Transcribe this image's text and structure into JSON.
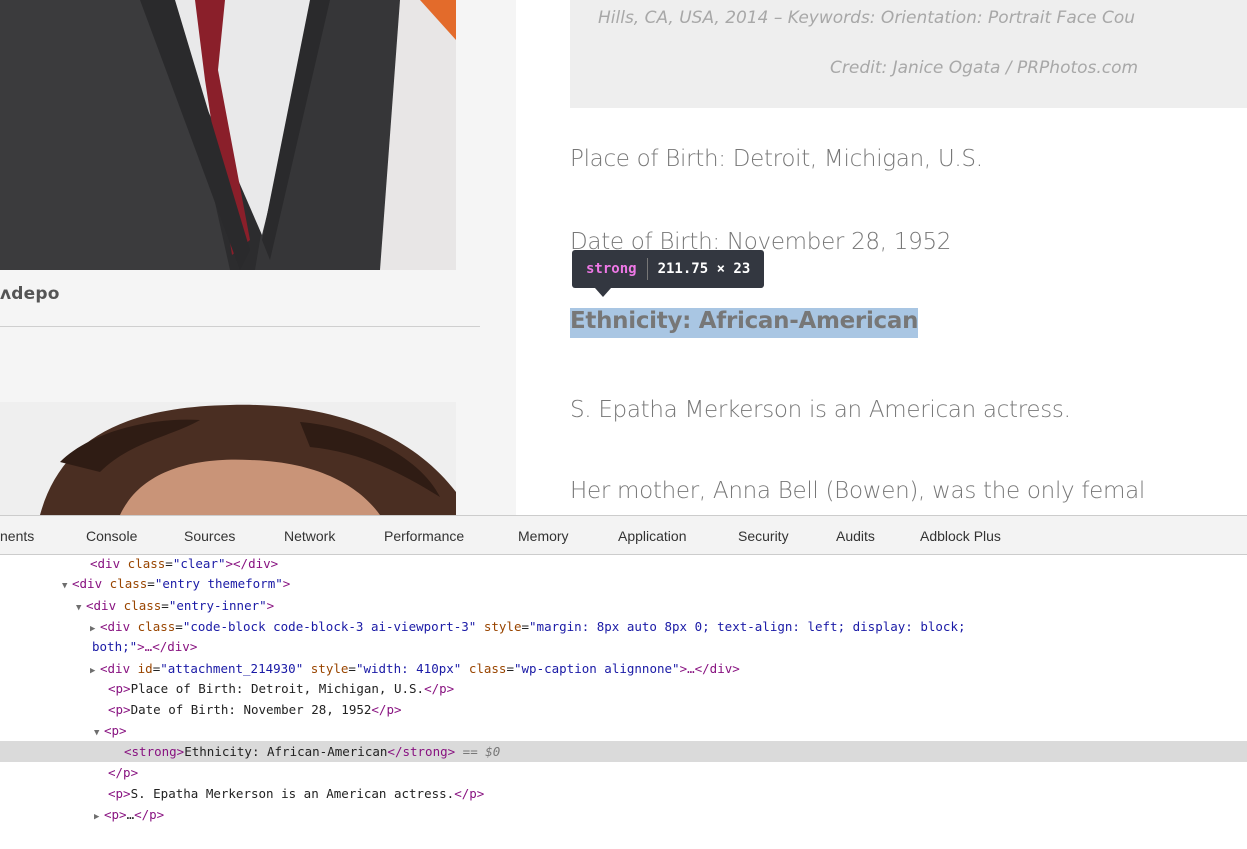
{
  "webpage": {
    "sidebar": {
      "caption_fragment": "ʌdepo"
    },
    "photo_caption": {
      "line1": "Hills, CA, USA, 2014 – Keywords: Orientation: Portrait Face Cou",
      "line2": "Credit: Janice Ogata / PRPhotos.com"
    },
    "paragraphs": {
      "place_of_birth": "Place of Birth: Detroit, Michigan, U.S.",
      "date_of_birth": "Date of Birth: November 28, 1952",
      "ethnicity": "Ethnicity: African-American",
      "about": "S. Epatha Merkerson is an American actress.",
      "mother": "Her mother, Anna Bell (Bowen), was the only femal"
    },
    "highlight_color": "#a9c6e3"
  },
  "inspector_tooltip": {
    "tag": "strong",
    "size": "211.75 × 23"
  },
  "devtools": {
    "tabs": [
      {
        "label": "nents",
        "active": true
      },
      {
        "label": "Console",
        "active": false
      },
      {
        "label": "Sources",
        "active": false
      },
      {
        "label": "Network",
        "active": false
      },
      {
        "label": "Performance",
        "active": false
      },
      {
        "label": "Memory",
        "active": false
      },
      {
        "label": "Application",
        "active": false
      },
      {
        "label": "Security",
        "active": false
      },
      {
        "label": "Audits",
        "active": false
      },
      {
        "label": "Adblock Plus",
        "active": false
      }
    ],
    "dom_lines": {
      "l1": {
        "open": "<div",
        "attr1_name": "class",
        "attr1_value": "\"clear\"",
        "close": "></div>"
      },
      "l2": {
        "open": "<div",
        "attr1_name": "class",
        "attr1_value": "\"entry themeform\"",
        "close": ">"
      },
      "l3": {
        "open": "<div",
        "attr1_name": "class",
        "attr1_value": "\"entry-inner\"",
        "close": ">"
      },
      "l4": {
        "open": "<div",
        "attr1_name": "class",
        "attr1_value": "\"code-block code-block-3 ai-viewport-3\"",
        "attr2_name": "style",
        "attr2_value": "\"margin: 8px auto 8px 0; text-align: left; display: block;"
      },
      "l5": {
        "attr2_value_cont": "both;\"",
        "close": ">…</div>"
      },
      "l6": {
        "open": "<div",
        "attr1_name": "id",
        "attr1_value": "\"attachment_214930\"",
        "attr2_name": "style",
        "attr2_value": "\"width: 410px\"",
        "attr3_name": "class",
        "attr3_value": "\"wp-caption alignnone\"",
        "close": ">…</div>"
      },
      "l7": {
        "open": "<p>",
        "text": "Place of Birth: Detroit, Michigan, U.S.",
        "close": "</p>"
      },
      "l8": {
        "open": "<p>",
        "text": "Date of Birth: November 28, 1952",
        "close": "</p>"
      },
      "l9": {
        "open": "<p>"
      },
      "l10": {
        "open": "<strong>",
        "text": "Ethnicity: African-American",
        "close": "</strong>",
        "marker": " == $0"
      },
      "l11": {
        "close": "</p>"
      },
      "l12": {
        "open": "<p>",
        "text": "S. Epatha Merkerson is an American actress.",
        "close": "</p>"
      },
      "l13": {
        "open": "<p>",
        "text": "…",
        "close": "</p>"
      }
    }
  }
}
